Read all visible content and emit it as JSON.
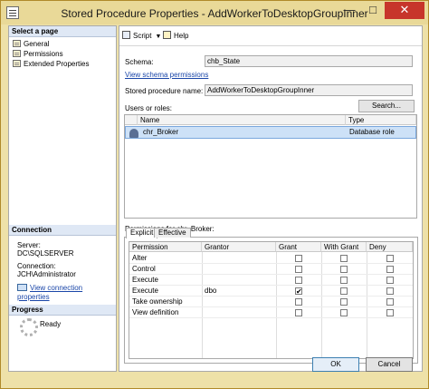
{
  "window": {
    "title": "Stored Procedure Properties - AddWorkerToDesktopGroupInner",
    "min_glyph": "—",
    "max_glyph": "□",
    "close_glyph": "✕"
  },
  "left": {
    "select_page_header": "Select a page",
    "pages": [
      {
        "label": "General"
      },
      {
        "label": "Permissions"
      },
      {
        "label": "Extended Properties"
      }
    ],
    "connection_header": "Connection",
    "server_label": "Server:",
    "server_value": "DC\\SQLSERVER",
    "connection_label": "Connection:",
    "connection_value": "JCH\\Administrator",
    "view_connection_link": "View connection properties",
    "progress_header": "Progress",
    "progress_status": "Ready"
  },
  "toolbar": {
    "script_label": "Script",
    "help_label": "Help"
  },
  "main": {
    "schema_label": "Schema:",
    "schema_value": "chb_State",
    "view_schema_link": "View schema permissions",
    "sp_name_label": "Stored procedure name:",
    "sp_name_value": "AddWorkerToDesktopGroupInner",
    "users_roles_label": "Users or roles:",
    "search_button": "Search...",
    "users_grid": {
      "columns": [
        "Name",
        "Type"
      ],
      "rows": [
        {
          "name": "chr_Broker",
          "type": "Database role"
        }
      ]
    },
    "permissions_for_label": "Permissions for chr_Broker:",
    "tabs": [
      {
        "label": "Explicit"
      },
      {
        "label": "Effective"
      }
    ],
    "perm_grid": {
      "columns": [
        "Permission",
        "Grantor",
        "Grant",
        "With Grant",
        "Deny"
      ],
      "rows": [
        {
          "permission": "Alter",
          "grantor": "",
          "grant": false,
          "with_grant": false,
          "deny": false
        },
        {
          "permission": "Control",
          "grantor": "",
          "grant": false,
          "with_grant": false,
          "deny": false
        },
        {
          "permission": "Execute",
          "grantor": "",
          "grant": false,
          "with_grant": false,
          "deny": false
        },
        {
          "permission": "Execute",
          "grantor": "dbo",
          "grant": true,
          "with_grant": false,
          "deny": false
        },
        {
          "permission": "Take ownership",
          "grantor": "",
          "grant": false,
          "with_grant": false,
          "deny": false
        },
        {
          "permission": "View definition",
          "grantor": "",
          "grant": false,
          "with_grant": false,
          "deny": false
        }
      ]
    }
  },
  "footer": {
    "ok_label": "OK",
    "cancel_label": "Cancel"
  }
}
